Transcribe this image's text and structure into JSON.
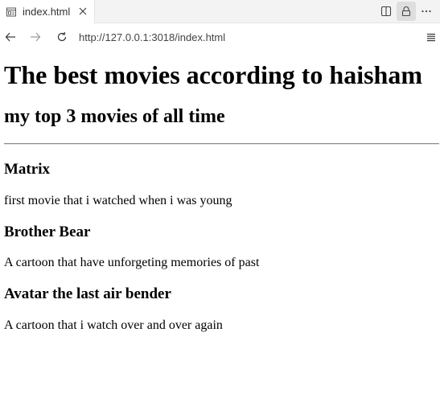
{
  "browser": {
    "tab": {
      "title": "index.html",
      "icon": "page-icon",
      "close_icon": "close-icon"
    },
    "toolbar_icons": [
      "split-view-icon",
      "lock-icon",
      "more-icon"
    ],
    "nav": {
      "back_icon": "back-arrow-icon",
      "forward_icon": "forward-arrow-icon",
      "reload_icon": "reload-icon",
      "menu_icon": "menu-icon"
    },
    "url": "http://127.0.0.1:3018/index.html"
  },
  "page": {
    "heading": "The best movies according to haisham",
    "subheading": "my top 3 movies of all time",
    "movies": [
      {
        "title": "Matrix",
        "description": "first movie that i watched when i was young"
      },
      {
        "title": "Brother Bear",
        "description": "A cartoon that have unforgeting memories of past"
      },
      {
        "title": "Avatar the last air bender",
        "description": "A cartoon that i watch over and over again"
      }
    ]
  }
}
